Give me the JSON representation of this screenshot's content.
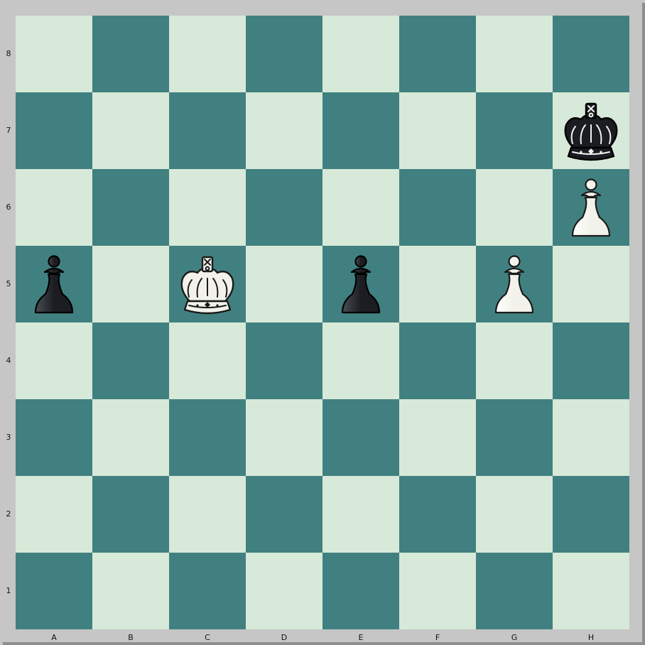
{
  "board": {
    "files": [
      "A",
      "B",
      "C",
      "D",
      "E",
      "F",
      "G",
      "H"
    ],
    "ranks": [
      "8",
      "7",
      "6",
      "5",
      "4",
      "3",
      "2",
      "1"
    ],
    "colors": {
      "light": "#d7e9d8",
      "dark": "#418080"
    },
    "pieces": [
      {
        "square": "h7",
        "type": "king",
        "color": "black"
      },
      {
        "square": "h6",
        "type": "pawn",
        "color": "white"
      },
      {
        "square": "a5",
        "type": "pawn",
        "color": "black"
      },
      {
        "square": "c5",
        "type": "king",
        "color": "white"
      },
      {
        "square": "e5",
        "type": "pawn",
        "color": "black"
      },
      {
        "square": "g5",
        "type": "pawn",
        "color": "white"
      }
    ]
  }
}
